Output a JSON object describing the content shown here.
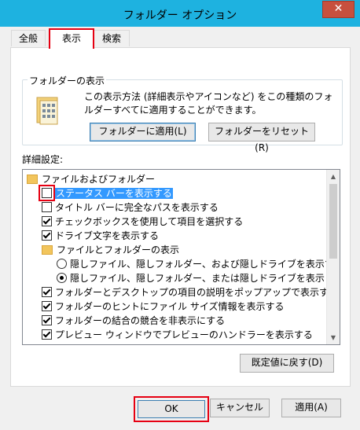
{
  "window": {
    "title": "フォルダー オプション",
    "close_glyph": "✕"
  },
  "tabs": [
    {
      "label": "全般"
    },
    {
      "label": "表示"
    },
    {
      "label": "検索"
    }
  ],
  "folder_views": {
    "legend": "フォルダーの表示",
    "description": "この表示方法 (詳細表示やアイコンなど) をこの種類のフォルダーすべてに適用することができます。",
    "apply_button": "フォルダーに適用(L)",
    "reset_button": "フォルダーをリセット(R)"
  },
  "advanced": {
    "label": "詳細設定:",
    "items": [
      {
        "type": "folder",
        "label": "ファイルおよびフォルダー"
      },
      {
        "type": "checkbox",
        "checked": false,
        "label": "ステータス バーを表示する"
      },
      {
        "type": "checkbox",
        "checked": false,
        "label": "タイトル バーに完全なパスを表示する"
      },
      {
        "type": "checkbox",
        "checked": true,
        "label": "チェックボックスを使用して項目を選択する"
      },
      {
        "type": "checkbox",
        "checked": true,
        "label": "ドライブ文字を表示する"
      },
      {
        "type": "folder",
        "label": "ファイルとフォルダーの表示"
      },
      {
        "type": "radio",
        "checked": false,
        "label": "隠しファイル、隠しフォルダー、および隠しドライブを表示する"
      },
      {
        "type": "radio",
        "checked": true,
        "label": "隠しファイル、隠しフォルダー、または隠しドライブを表示しない"
      },
      {
        "type": "checkbox",
        "checked": true,
        "label": "フォルダーとデスクトップの項目の説明をポップアップで表示する"
      },
      {
        "type": "checkbox",
        "checked": true,
        "label": "フォルダーのヒントにファイル サイズ情報を表示する"
      },
      {
        "type": "checkbox",
        "checked": true,
        "label": "フォルダーの結合の競合を非表示にする"
      },
      {
        "type": "checkbox",
        "checked": true,
        "label": "プレビュー ウィンドウでプレビューのハンドラーを表示する"
      }
    ],
    "restore_defaults_button": "既定値に戻す(D)"
  },
  "footer": {
    "ok": "OK",
    "cancel": "キャンセル",
    "apply": "適用(A)"
  },
  "colors": {
    "title_bar": "#1eb2e0",
    "close_button": "#c7503e",
    "annotation_red": "#e60012",
    "selection": "#3399ff"
  }
}
